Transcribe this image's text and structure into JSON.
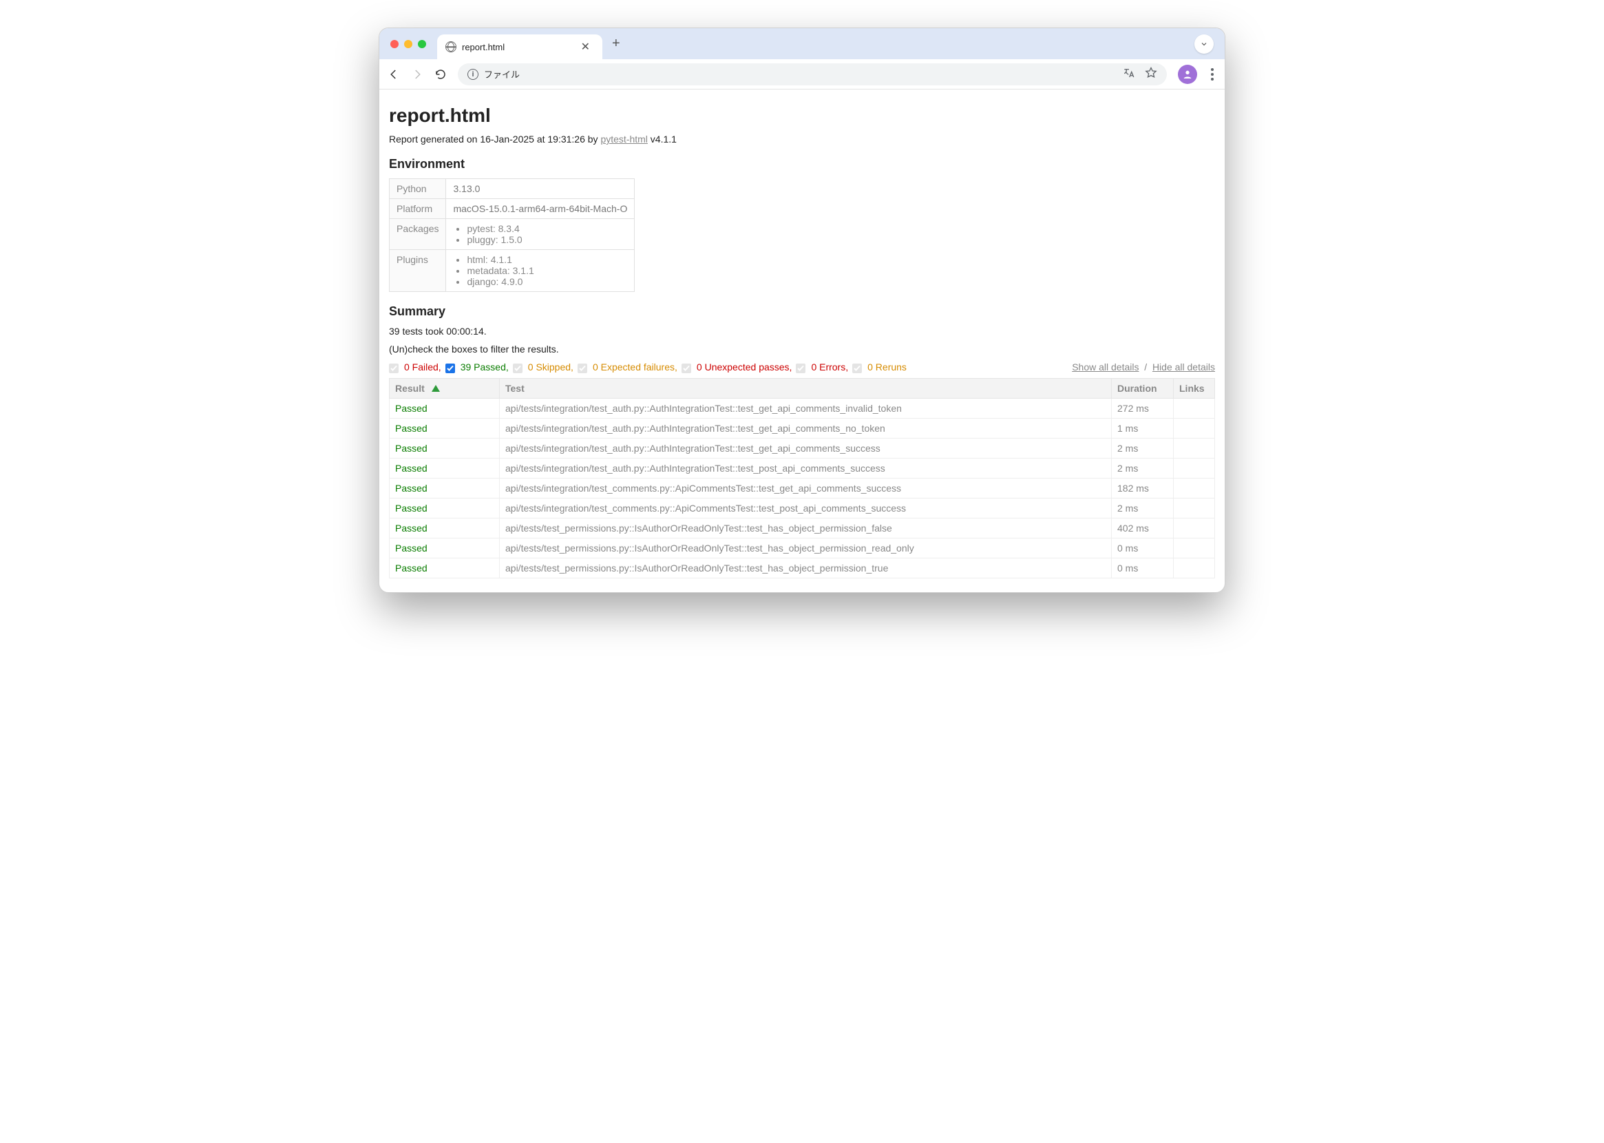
{
  "browser": {
    "tab_title": "report.html",
    "omnibox_label": "ファイル"
  },
  "page": {
    "title": "report.html",
    "generated_prefix": "Report generated on 16-Jan-2025 at 19:31:26 by ",
    "plugin_link": "pytest-html",
    "plugin_version": " v4.1.1",
    "env_heading": "Environment",
    "env": {
      "python_label": "Python",
      "python_value": "3.13.0",
      "platform_label": "Platform",
      "platform_value": "macOS-15.0.1-arm64-arm-64bit-Mach-O",
      "packages_label": "Packages",
      "packages": [
        "pytest: 8.3.4",
        "pluggy: 1.5.0"
      ],
      "plugins_label": "Plugins",
      "plugins": [
        "html: 4.1.1",
        "metadata: 3.1.1",
        "django: 4.9.0"
      ]
    },
    "summary_heading": "Summary",
    "summary_line": "39 tests took 00:00:14.",
    "filter_hint": "(Un)check the boxes to filter the results.",
    "filters": {
      "failed": "0 Failed,",
      "passed": "39 Passed,",
      "skipped": "0 Skipped,",
      "xfail": "0 Expected failures,",
      "xpass": "0 Unexpected passes,",
      "errors": "0 Errors,",
      "reruns": "0 Reruns"
    },
    "show_all": "Show all details",
    "hide_all": "Hide all details",
    "headers": {
      "result": "Result",
      "test": "Test",
      "duration": "Duration",
      "links": "Links"
    },
    "rows": [
      {
        "result": "Passed",
        "test": "api/tests/integration/test_auth.py::AuthIntegrationTest::test_get_api_comments_invalid_token",
        "duration": "272 ms"
      },
      {
        "result": "Passed",
        "test": "api/tests/integration/test_auth.py::AuthIntegrationTest::test_get_api_comments_no_token",
        "duration": "1 ms"
      },
      {
        "result": "Passed",
        "test": "api/tests/integration/test_auth.py::AuthIntegrationTest::test_get_api_comments_success",
        "duration": "2 ms"
      },
      {
        "result": "Passed",
        "test": "api/tests/integration/test_auth.py::AuthIntegrationTest::test_post_api_comments_success",
        "duration": "2 ms"
      },
      {
        "result": "Passed",
        "test": "api/tests/integration/test_comments.py::ApiCommentsTest::test_get_api_comments_success",
        "duration": "182 ms"
      },
      {
        "result": "Passed",
        "test": "api/tests/integration/test_comments.py::ApiCommentsTest::test_post_api_comments_success",
        "duration": "2 ms"
      },
      {
        "result": "Passed",
        "test": "api/tests/test_permissions.py::IsAuthorOrReadOnlyTest::test_has_object_permission_false",
        "duration": "402 ms"
      },
      {
        "result": "Passed",
        "test": "api/tests/test_permissions.py::IsAuthorOrReadOnlyTest::test_has_object_permission_read_only",
        "duration": "0 ms"
      },
      {
        "result": "Passed",
        "test": "api/tests/test_permissions.py::IsAuthorOrReadOnlyTest::test_has_object_permission_true",
        "duration": "0 ms"
      }
    ]
  }
}
